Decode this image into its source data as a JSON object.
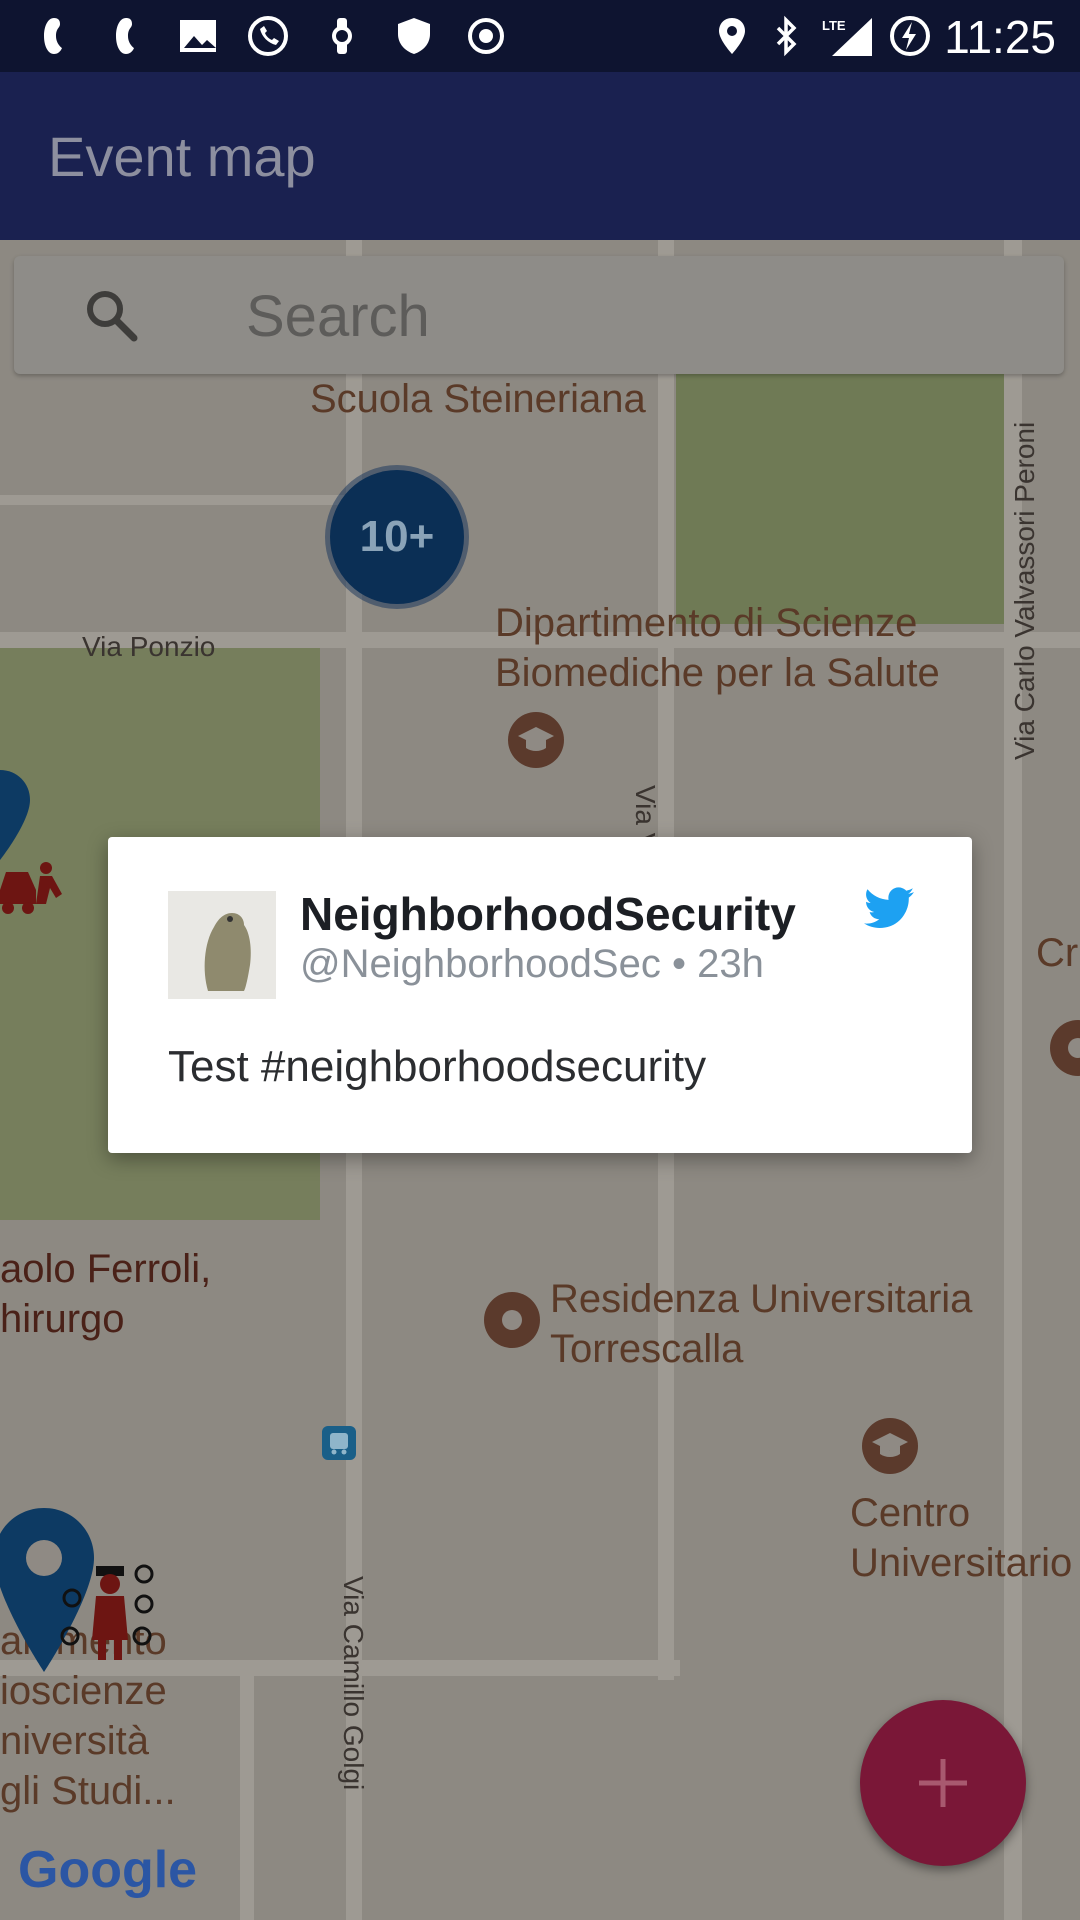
{
  "status_bar": {
    "time": "11:25",
    "left_icons": [
      "notification-icon",
      "notification-icon",
      "image-icon",
      "whatsapp-icon",
      "watch-icon",
      "shield-icon",
      "record-icon"
    ],
    "right_icons": [
      "location-icon",
      "bluetooth-icon",
      "lte-signal-icon",
      "battery-charging-icon"
    ],
    "network": "LTE"
  },
  "app_bar": {
    "title": "Event map"
  },
  "search": {
    "placeholder": "Search"
  },
  "map": {
    "labels": {
      "scuola": "Scuola Steineriana",
      "dipartimento": "Dipartimento di Scienze Biomediche per la Salute",
      "via_ponzio": "Via Ponzio",
      "via_valvassori": "Via Carlo Valvassori Peroni",
      "via_v": "Via V",
      "ferroli": "aolo Ferroli, hirurgo",
      "residenza": "Residenza Universitaria Torrescalla",
      "centro": "Centro Universitario",
      "cr": "Cr",
      "biosc": "artimento ioscienze niversità gli Studi...",
      "via_golgi": "Via Camillo Golgi"
    },
    "cluster_label": "10+",
    "attribution": "Google"
  },
  "tweet": {
    "username": "NeighborhoodSecurity",
    "handle": "@NeighborhoodSec",
    "separator": "•",
    "age": "23h",
    "text": "Test #neighborhoodsecurity"
  },
  "fab": {
    "icon": "plus-icon"
  },
  "colors": {
    "status_bar": "#0e1430",
    "app_bar": "#1a2150",
    "cluster": "#0b2f55",
    "fab": "#7a1737",
    "twitter": "#1da1f2"
  }
}
